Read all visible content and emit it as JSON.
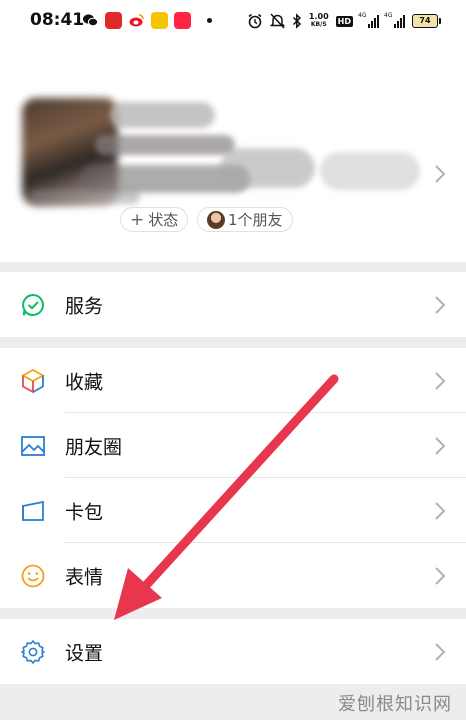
{
  "status_bar": {
    "time": "08:41",
    "net_speed_value": "1.00",
    "net_speed_unit": "KB/S",
    "hd_label": "HD",
    "signal_1_label": "4G",
    "signal_2_label": "4G",
    "battery": "74",
    "apps": [
      {
        "icon": "wechat-icon",
        "color": "#111111"
      },
      {
        "icon": "app-red-icon",
        "color": "#e02a2a"
      },
      {
        "icon": "weibo-icon",
        "color": "#e8a000"
      },
      {
        "icon": "app-yellow-icon",
        "color": "#f3c400"
      },
      {
        "icon": "xiaohongshu-icon",
        "color": "#ff2442"
      }
    ]
  },
  "profile": {
    "status_button": "状态",
    "friends_button": "1个朋友"
  },
  "menu": {
    "service": "服务",
    "favorites": "收藏",
    "moments": "朋友圈",
    "cards": "卡包",
    "stickers": "表情",
    "settings": "设置"
  },
  "watermark": "爱刨根知识网",
  "colors": {
    "arrow": "#e8374d",
    "wechat_green": "#07c160",
    "icon_blue": "#2a7fd4",
    "background": "#ededed"
  }
}
